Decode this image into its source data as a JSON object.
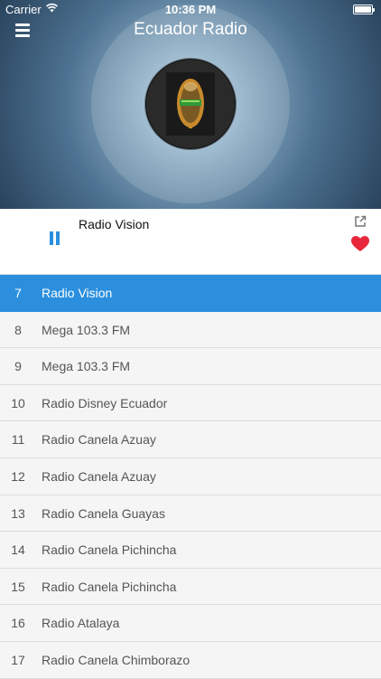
{
  "status": {
    "carrier": "Carrier",
    "time": "10:36 PM"
  },
  "app": {
    "title": "Ecuador Radio"
  },
  "player": {
    "station": "Radio Vision",
    "state": "playing"
  },
  "colors": {
    "accent": "#2b8fde",
    "favorite": "#e8273c"
  },
  "icons": {
    "menu": "menu-icon",
    "pause": "pause-icon",
    "share": "share-icon",
    "favorite": "heart-icon"
  },
  "stations": [
    {
      "number": "7",
      "name": "Radio Vision",
      "active": true
    },
    {
      "number": "8",
      "name": "Mega 103.3 FM"
    },
    {
      "number": "9",
      "name": "Mega 103.3 FM"
    },
    {
      "number": "10",
      "name": "Radio Disney Ecuador"
    },
    {
      "number": "11",
      "name": "Radio Canela Azuay"
    },
    {
      "number": "12",
      "name": "Radio Canela Azuay"
    },
    {
      "number": "13",
      "name": "Radio Canela Guayas"
    },
    {
      "number": "14",
      "name": "Radio Canela Pichincha"
    },
    {
      "number": "15",
      "name": "Radio Canela Pichincha"
    },
    {
      "number": "16",
      "name": "Radio Atalaya"
    },
    {
      "number": "17",
      "name": "Radio Canela Chimborazo"
    }
  ]
}
